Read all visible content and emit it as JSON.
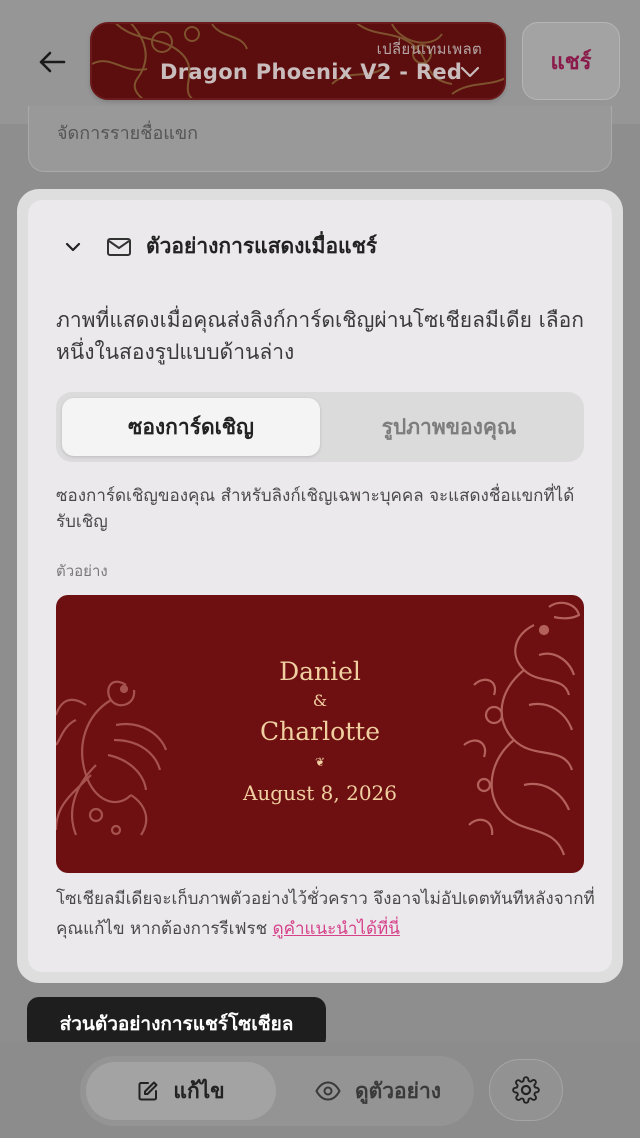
{
  "header": {
    "template_switch_label": "เปลี่ยนเทมเพลต",
    "template_name": "Dragon Phoenix V2 - Red",
    "share_label": "แชร์"
  },
  "background_card": {
    "label": "จัดการรายชื่อแขก"
  },
  "section": {
    "title": "ตัวอย่างการแสดงเมื่อแชร์",
    "description": "ภาพที่แสดงเมื่อคุณส่งลิงก์การ์ดเชิญผ่านโซเชียลมีเดีย เลือกหนึ่งในสองรูปแบบด้านล่าง",
    "options": [
      {
        "label": "ซองการ์ดเชิญ",
        "selected": true
      },
      {
        "label": "รูปภาพของคุณ",
        "selected": false
      }
    ],
    "option_description": "ซองการ์ดเชิญของคุณ สำหรับลิงก์เชิญเฉพาะบุคคล จะแสดงชื่อแขกที่ได้รับเชิญ",
    "preview_label": "ตัวอย่าง",
    "preview": {
      "name1": "Daniel",
      "ampersand": "&",
      "name2": "Charlotte",
      "ornament": "❦",
      "date": "August 8, 2026",
      "background_color": "#6e0f12",
      "text_color": "#f0cfa0"
    },
    "note": "โซเชียลมีเดียจะเก็บภาพตัวอย่างไว้ชั่วคราว จึงอาจไม่อัปเดตทันทีหลังจากที่คุณแก้ไข หากต้องการรีเฟรช",
    "note_link": "ดูคำแนะนำได้ที่นี่"
  },
  "tooltip": {
    "text": "ส่วนตัวอย่างการแชร์โซเชียล"
  },
  "bottom_bar": {
    "edit_label": "แก้ไข",
    "preview_label": "ดูตัวอย่าง",
    "edit_icon": "edit-icon",
    "preview_icon": "eye-icon",
    "settings_icon": "gear-icon"
  },
  "colors": {
    "accent": "#d6418a",
    "share_text": "#8a1a4a"
  }
}
